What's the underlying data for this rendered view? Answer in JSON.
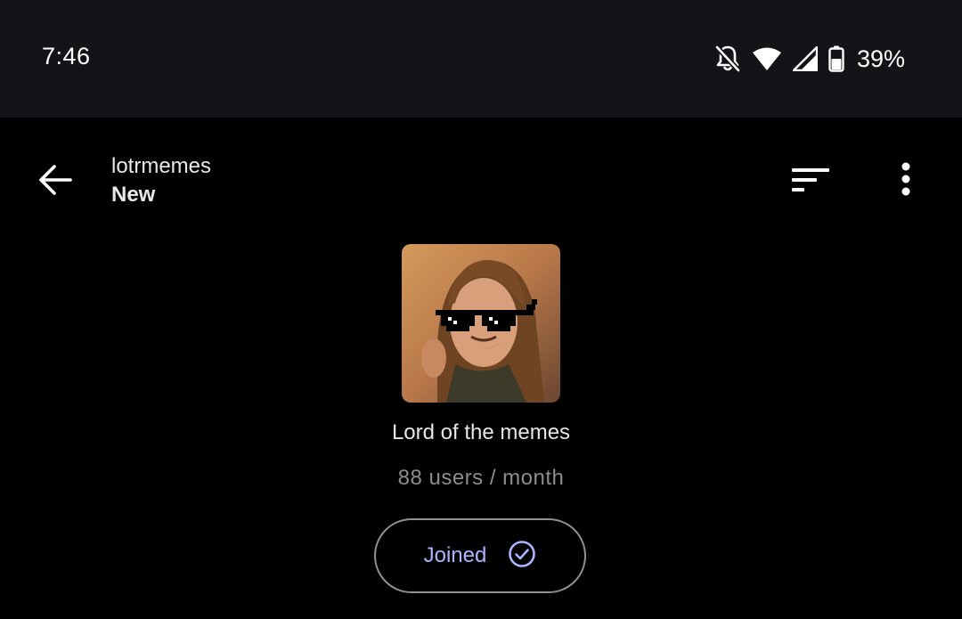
{
  "status_bar": {
    "time": "7:46",
    "battery_percent": "39%",
    "icons": [
      "notifications-off-icon",
      "wifi-icon",
      "cell-signal-icon",
      "battery-icon"
    ]
  },
  "app_bar": {
    "community_name": "lotrmemes",
    "sort_label": "New",
    "icons": [
      "back-arrow-icon",
      "sort-icon",
      "more-vert-icon"
    ]
  },
  "community": {
    "title": "Lord of the memes",
    "stats": "88 users / month",
    "join_button_label": "Joined",
    "join_button_icon": "check-circle-icon",
    "avatar_alt": "community-avatar"
  },
  "colors": {
    "status_bar_bg": "#131418",
    "page_bg": "#000000",
    "accent": "#aab4ff",
    "muted_text": "#8c8c8c"
  }
}
